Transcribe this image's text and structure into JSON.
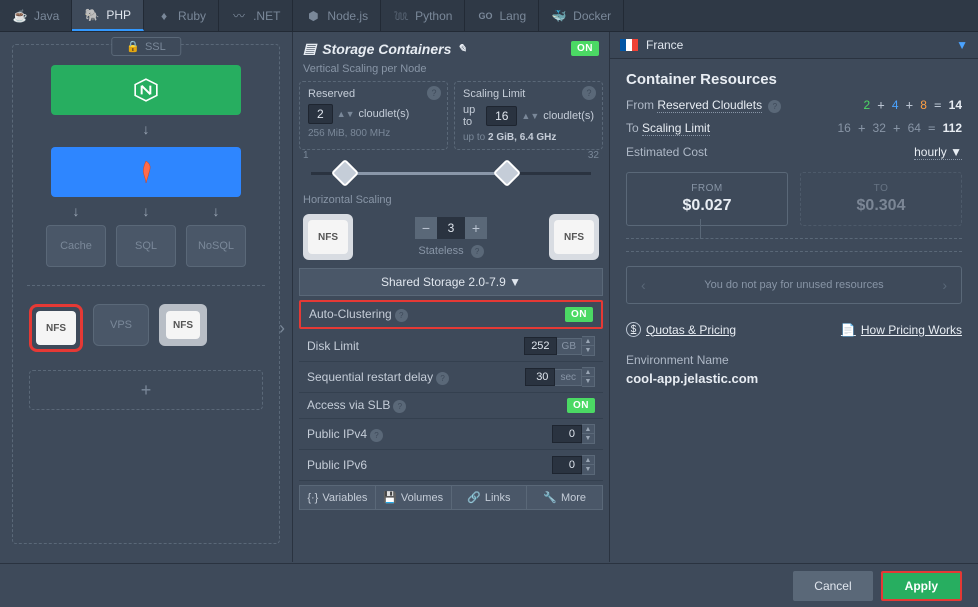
{
  "tabs": [
    {
      "label": "Java"
    },
    {
      "label": "PHP"
    },
    {
      "label": "Ruby"
    },
    {
      "label": ".NET"
    },
    {
      "label": "Node.js"
    },
    {
      "label": "Python"
    },
    {
      "label": "Lang"
    },
    {
      "label": "Docker"
    }
  ],
  "topology": {
    "ssl": "SSL",
    "cache": "Cache",
    "sql": "SQL",
    "nosql": "NoSQL",
    "nfs": "NFS",
    "vps": "VPS",
    "plus": "+"
  },
  "storage": {
    "title": "Storage Containers",
    "toggle": "ON",
    "vscaling_label": "Vertical Scaling per Node",
    "reserved": {
      "title": "Reserved",
      "value": "2",
      "unit": "cloudlet(s)",
      "sub": "256 MiB, 800 MHz"
    },
    "limit": {
      "title": "Scaling Limit",
      "prefix": "up to",
      "value": "16",
      "unit": "cloudlet(s)",
      "sub_prefix": "up to",
      "sub": "2 GiB, 6.4 GHz"
    },
    "slider_min": "1",
    "slider_max": "32",
    "hscaling_label": "Horizontal Scaling",
    "hs_count": "3",
    "stateless": "Stateless",
    "shared": "Shared Storage 2.0-7.9",
    "auto_cluster": "Auto-Clustering",
    "auto_cluster_state": "ON",
    "disk": {
      "label": "Disk Limit",
      "value": "252",
      "unit": "GB"
    },
    "restart": {
      "label": "Sequential restart delay",
      "value": "30",
      "unit": "sec"
    },
    "slb": {
      "label": "Access via SLB",
      "state": "ON"
    },
    "ipv4": {
      "label": "Public IPv4",
      "value": "0"
    },
    "ipv6": {
      "label": "Public IPv6",
      "value": "0"
    },
    "btns": {
      "vars": "Variables",
      "vols": "Volumes",
      "links": "Links",
      "more": "More"
    }
  },
  "region": {
    "name": "France"
  },
  "resources": {
    "title": "Container Resources",
    "from_label": "From",
    "reserved_label": "Reserved Cloudlets",
    "from_math": {
      "a": "2",
      "b": "4",
      "c": "8",
      "eq": "14"
    },
    "to_label": "To",
    "limit_label": "Scaling Limit",
    "to_math": {
      "a": "16",
      "b": "32",
      "c": "64",
      "eq": "112"
    },
    "cost_label": "Estimated Cost",
    "cost_mode": "hourly",
    "from_card": "FROM",
    "from_price": "$0.027",
    "to_card": "TO",
    "to_price": "$0.304",
    "info": "You do not pay for unused resources",
    "quotas": "Quotas & Pricing",
    "howworks": "How Pricing Works",
    "env_label": "Environment Name",
    "env_value": "cool-app.jelastic.com"
  },
  "footer": {
    "cancel": "Cancel",
    "apply": "Apply"
  }
}
